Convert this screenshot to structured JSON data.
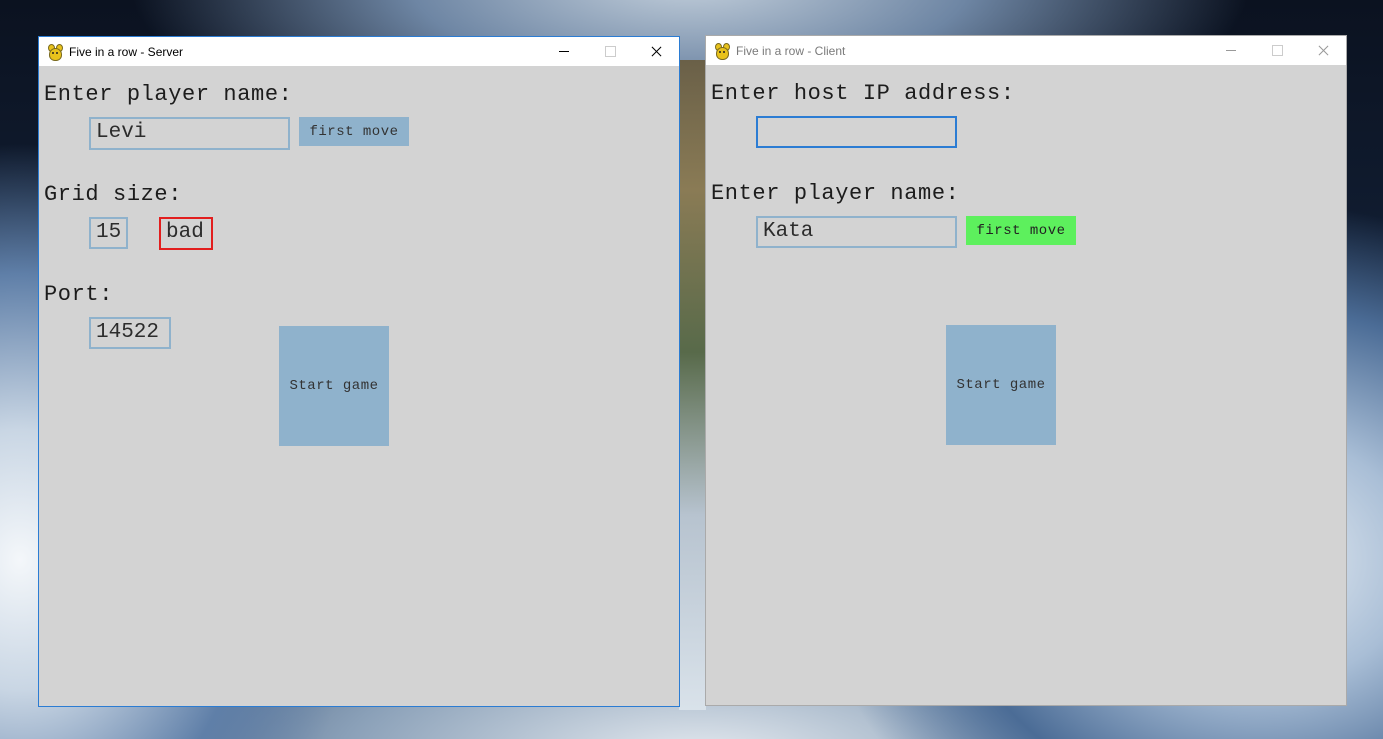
{
  "server": {
    "title": "Five in a row - Server",
    "name_label": "Enter player name:",
    "name_value": "Levi",
    "first_move_label": "first move",
    "grid_label": "Grid size:",
    "grid_value": "15",
    "grid_status": "bad",
    "port_label": "Port:",
    "port_value": "14522",
    "start_label": "Start game"
  },
  "client": {
    "title": "Five in a row - Client",
    "host_label": "Enter host IP address:",
    "host_value": "",
    "name_label": "Enter player name:",
    "name_value": "Kata",
    "first_move_label": "first move",
    "start_label": "Start game"
  },
  "colors": {
    "panel": "#d3d3d3",
    "button": "#8fb2cc",
    "first_move_active": "#5df05d",
    "error_border": "#e21e1e",
    "focus_border": "#2b7cd3"
  },
  "icons": [
    "pygame-snake-icon",
    "minimize-icon",
    "maximize-icon",
    "close-icon"
  ]
}
